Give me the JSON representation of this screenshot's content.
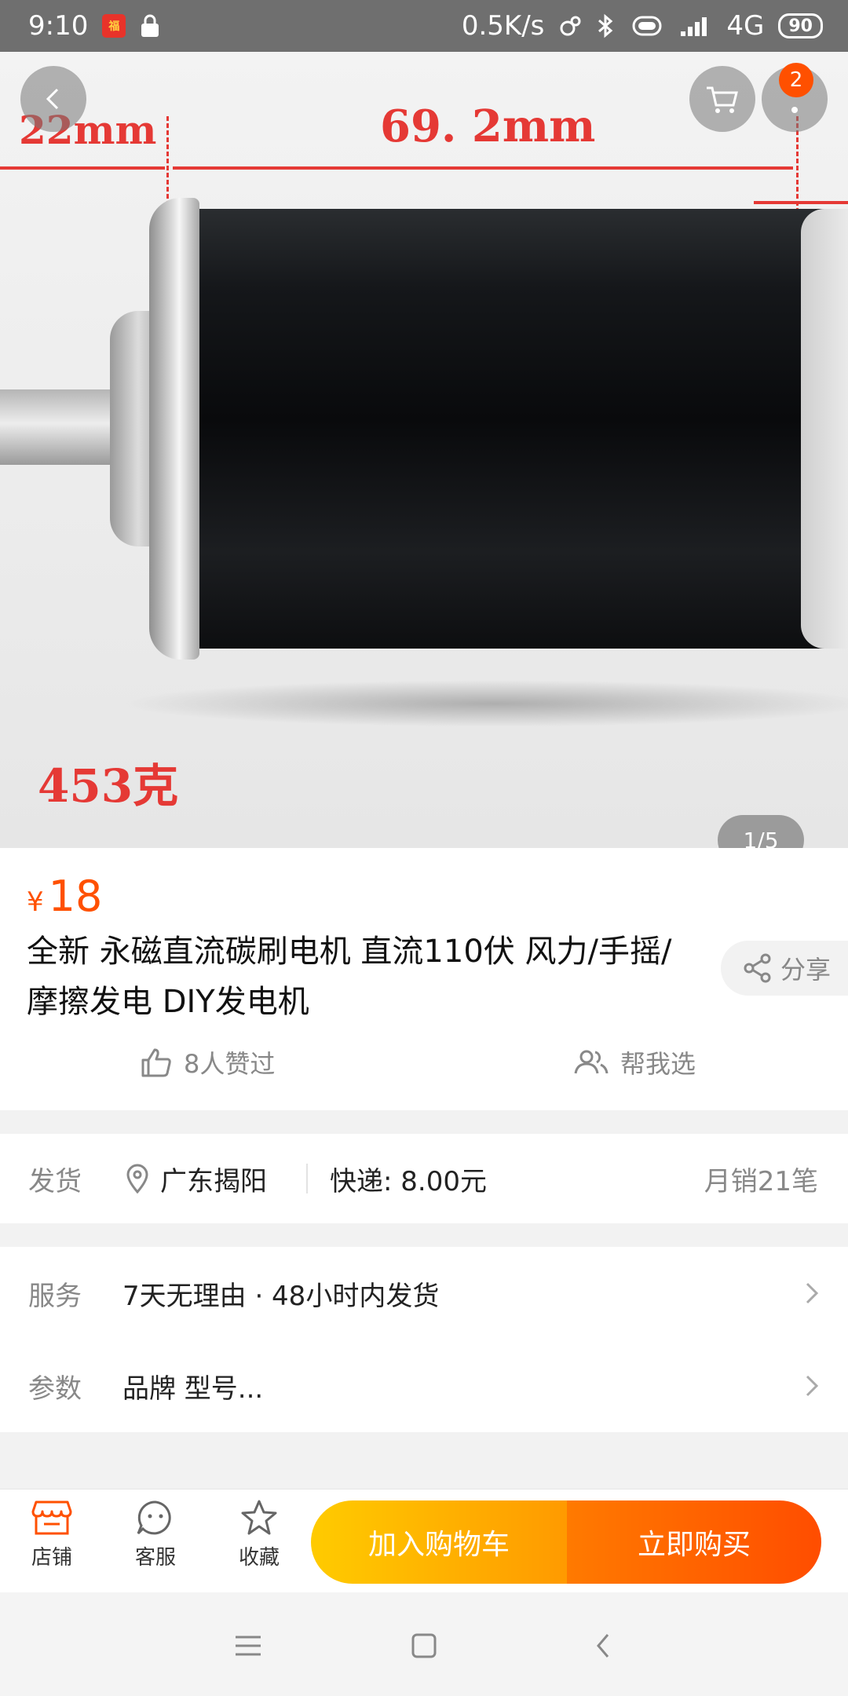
{
  "status_bar": {
    "time": "9:10",
    "network_speed": "0.5K/s",
    "signal_type": "4G",
    "battery": "90"
  },
  "hero": {
    "page_indicator": "1/5",
    "cart_badge": "2",
    "dimension_left": "22mm",
    "dimension_main": "69. 2mm",
    "weight_label": "453克"
  },
  "product": {
    "currency": "¥",
    "price": "18",
    "title": "全新  永磁直流碳刷电机  直流110伏  风力/手摇/摩擦发电  DIY发电机",
    "share_label": "分享",
    "likes_label": "8人赞过",
    "help_choose_label": "帮我选"
  },
  "shipping": {
    "label": "发货",
    "location": "广东揭阳",
    "fee": "快递: 8.00元",
    "monthly_sales": "月销21笔"
  },
  "services": {
    "service_label": "服务",
    "service_value": "7天无理由  ·  48小时内发货",
    "params_label": "参数",
    "params_value": "品牌 型号..."
  },
  "actions": {
    "store_label": "店铺",
    "service_label": "客服",
    "favorite_label": "收藏",
    "add_to_cart_label": "加入购物车",
    "buy_now_label": "立即购买"
  },
  "colors": {
    "accent": "#ff5000",
    "cart_button_gradient": [
      "#ffcb00",
      "#ff9a00"
    ],
    "buy_button_gradient": [
      "#ff7a00",
      "#ff4d00"
    ]
  }
}
